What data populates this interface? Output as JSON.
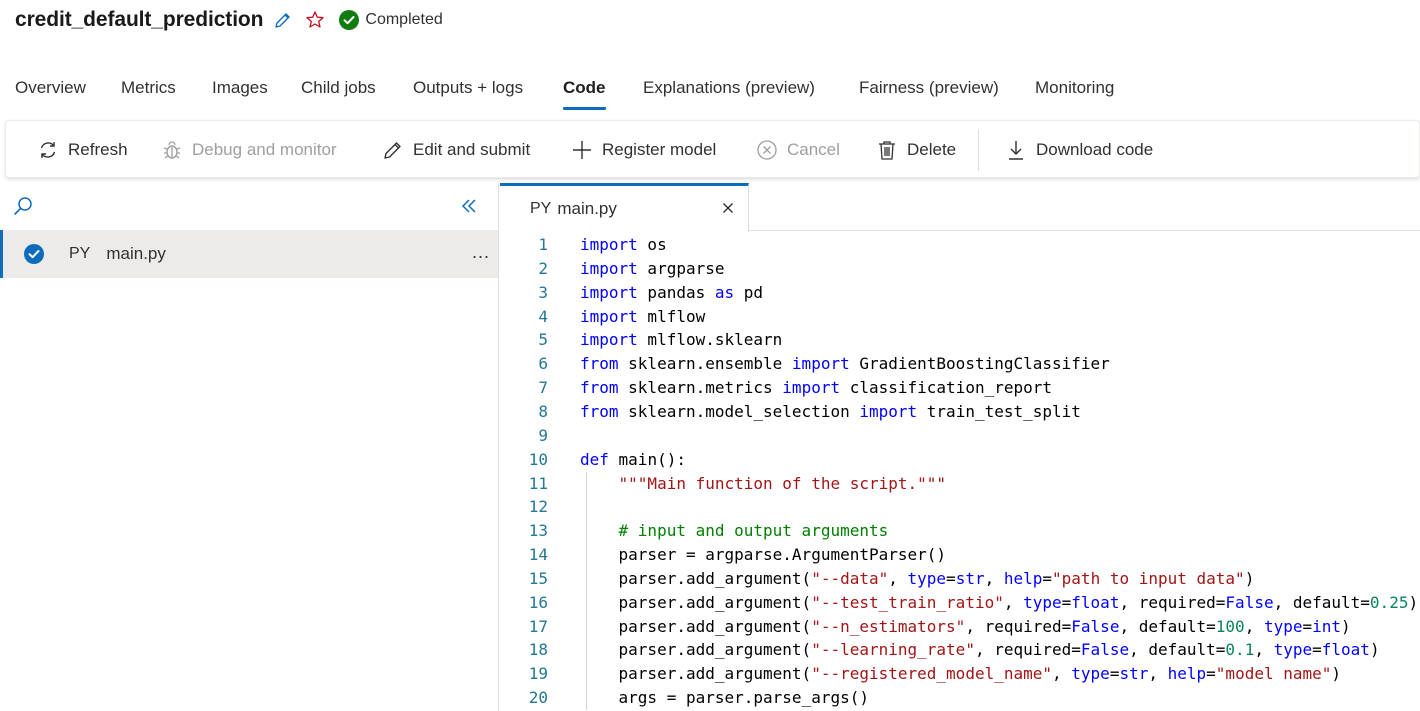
{
  "job": {
    "title": "credit_default_prediction",
    "status": "Completed"
  },
  "colors": {
    "accent": "#0f6cbd",
    "success": "#107c10",
    "keyword": "#0000ff",
    "string": "#a31515",
    "comment": "#008000",
    "number": "#098658",
    "line_number": "#237893"
  },
  "tabs": [
    {
      "label": "Overview"
    },
    {
      "label": "Metrics"
    },
    {
      "label": "Images"
    },
    {
      "label": "Child jobs"
    },
    {
      "label": "Outputs + logs"
    },
    {
      "label": "Code",
      "active": true
    },
    {
      "label": "Explanations (preview)"
    },
    {
      "label": "Fairness (preview)"
    },
    {
      "label": "Monitoring"
    }
  ],
  "toolbar": {
    "refresh": "Refresh",
    "debug": "Debug and monitor",
    "edit": "Edit and submit",
    "register": "Register model",
    "cancel": "Cancel",
    "delete": "Delete",
    "download": "Download code"
  },
  "file_tree": {
    "files": [
      {
        "type": "PY",
        "name": "main.py"
      }
    ],
    "more_label": "..."
  },
  "editor": {
    "tab": {
      "type": "PY",
      "name": "main.py"
    },
    "lines": [
      [
        {
          "t": "import",
          "c": "kw"
        },
        {
          "t": " os"
        }
      ],
      [
        {
          "t": "import",
          "c": "kw"
        },
        {
          "t": " argparse"
        }
      ],
      [
        {
          "t": "import",
          "c": "kw"
        },
        {
          "t": " pandas "
        },
        {
          "t": "as",
          "c": "kw"
        },
        {
          "t": " pd"
        }
      ],
      [
        {
          "t": "import",
          "c": "kw"
        },
        {
          "t": " mlflow"
        }
      ],
      [
        {
          "t": "import",
          "c": "kw"
        },
        {
          "t": " mlflow.sklearn"
        }
      ],
      [
        {
          "t": "from",
          "c": "kw"
        },
        {
          "t": " sklearn.ensemble "
        },
        {
          "t": "import",
          "c": "kw"
        },
        {
          "t": " GradientBoostingClassifier"
        }
      ],
      [
        {
          "t": "from",
          "c": "kw"
        },
        {
          "t": " sklearn.metrics "
        },
        {
          "t": "import",
          "c": "kw"
        },
        {
          "t": " classification_report"
        }
      ],
      [
        {
          "t": "from",
          "c": "kw"
        },
        {
          "t": " sklearn.model_selection "
        },
        {
          "t": "import",
          "c": "kw"
        },
        {
          "t": " train_test_split"
        }
      ],
      [],
      [
        {
          "t": "def",
          "c": "kw"
        },
        {
          "t": " main():"
        }
      ],
      [
        {
          "t": "    "
        },
        {
          "t": "\"\"\"Main function of the script.\"\"\"",
          "c": "str"
        }
      ],
      [],
      [
        {
          "t": "    "
        },
        {
          "t": "# input and output arguments",
          "c": "com"
        }
      ],
      [
        {
          "t": "    parser = argparse.ArgumentParser()"
        }
      ],
      [
        {
          "t": "    parser.add_argument("
        },
        {
          "t": "\"--data\"",
          "c": "str"
        },
        {
          "t": ", "
        },
        {
          "t": "type",
          "c": "kw"
        },
        {
          "t": "="
        },
        {
          "t": "str",
          "c": "kw"
        },
        {
          "t": ", "
        },
        {
          "t": "help",
          "c": "kw"
        },
        {
          "t": "="
        },
        {
          "t": "\"path to input data\"",
          "c": "str"
        },
        {
          "t": ")"
        }
      ],
      [
        {
          "t": "    parser.add_argument("
        },
        {
          "t": "\"--test_train_ratio\"",
          "c": "str"
        },
        {
          "t": ", "
        },
        {
          "t": "type",
          "c": "kw"
        },
        {
          "t": "="
        },
        {
          "t": "float",
          "c": "kw"
        },
        {
          "t": ", required="
        },
        {
          "t": "False",
          "c": "kw"
        },
        {
          "t": ", default="
        },
        {
          "t": "0.25",
          "c": "num"
        },
        {
          "t": ")"
        }
      ],
      [
        {
          "t": "    parser.add_argument("
        },
        {
          "t": "\"--n_estimators\"",
          "c": "str"
        },
        {
          "t": ", required="
        },
        {
          "t": "False",
          "c": "kw"
        },
        {
          "t": ", default="
        },
        {
          "t": "100",
          "c": "num"
        },
        {
          "t": ", "
        },
        {
          "t": "type",
          "c": "kw"
        },
        {
          "t": "="
        },
        {
          "t": "int",
          "c": "kw"
        },
        {
          "t": ")"
        }
      ],
      [
        {
          "t": "    parser.add_argument("
        },
        {
          "t": "\"--learning_rate\"",
          "c": "str"
        },
        {
          "t": ", required="
        },
        {
          "t": "False",
          "c": "kw"
        },
        {
          "t": ", default="
        },
        {
          "t": "0.1",
          "c": "num"
        },
        {
          "t": ", "
        },
        {
          "t": "type",
          "c": "kw"
        },
        {
          "t": "="
        },
        {
          "t": "float",
          "c": "kw"
        },
        {
          "t": ")"
        }
      ],
      [
        {
          "t": "    parser.add_argument("
        },
        {
          "t": "\"--registered_model_name\"",
          "c": "str"
        },
        {
          "t": ", "
        },
        {
          "t": "type",
          "c": "kw"
        },
        {
          "t": "="
        },
        {
          "t": "str",
          "c": "kw"
        },
        {
          "t": ", "
        },
        {
          "t": "help",
          "c": "kw"
        },
        {
          "t": "="
        },
        {
          "t": "\"model name\"",
          "c": "str"
        },
        {
          "t": ")"
        }
      ],
      [
        {
          "t": "    args = parser.parse_args()"
        }
      ]
    ]
  }
}
